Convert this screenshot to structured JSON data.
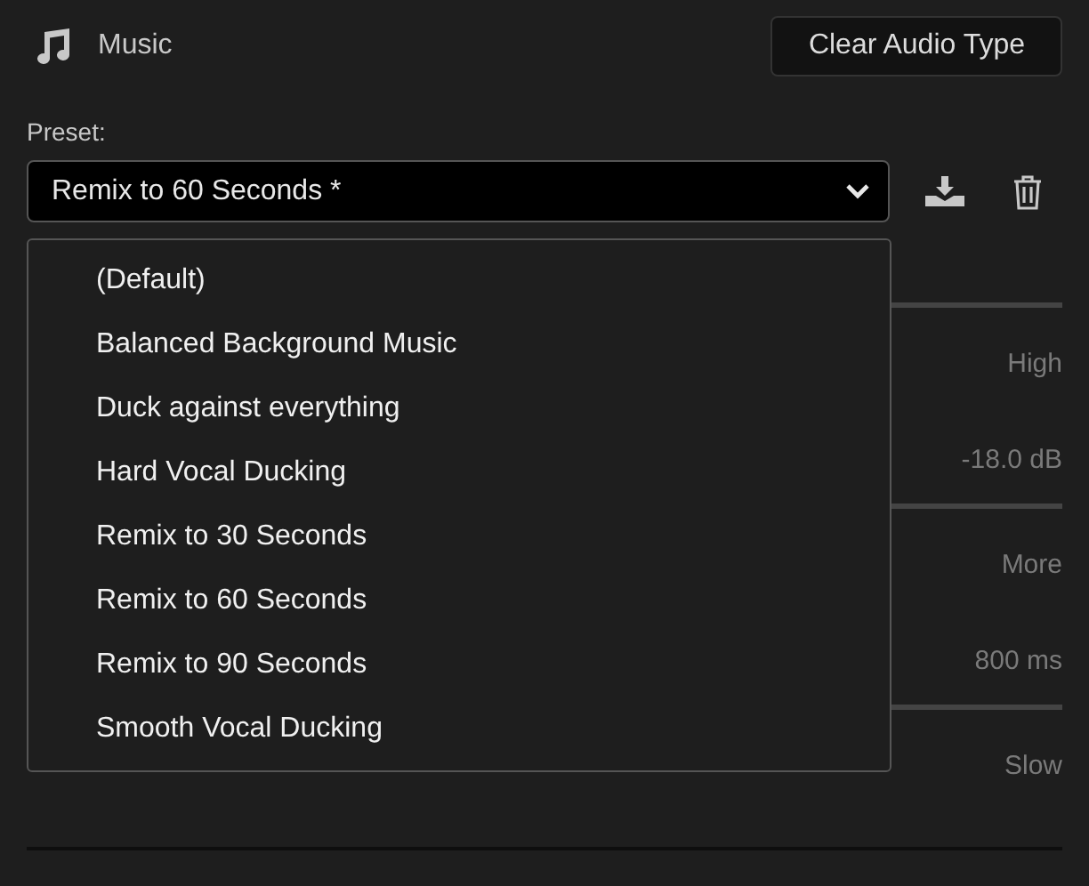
{
  "audio_type": {
    "label": "Music"
  },
  "clear_button": {
    "label": "Clear Audio Type"
  },
  "preset": {
    "label": "Preset:",
    "value": "Remix to 60 Seconds *",
    "expanded": true,
    "options": [
      {
        "label": "(Default)"
      },
      {
        "label": "Balanced Background Music"
      },
      {
        "label": "Duck against everything"
      },
      {
        "label": "Hard Vocal Ducking"
      },
      {
        "label": "Remix to 30 Seconds"
      },
      {
        "label": "Remix to 60 Seconds"
      },
      {
        "label": "Remix to 90 Seconds"
      },
      {
        "label": "Smooth Vocal Ducking"
      }
    ]
  },
  "settings": [
    {
      "max_label": "High",
      "reading": "-18.0 dB"
    },
    {
      "max_label": "More",
      "reading": "800 ms"
    },
    {
      "max_label": "Slow"
    }
  ]
}
